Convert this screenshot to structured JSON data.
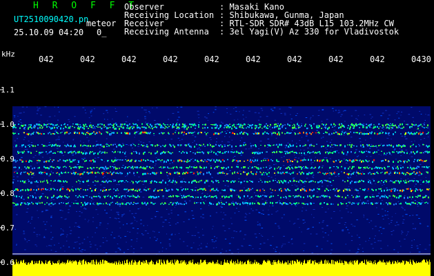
{
  "header": {
    "program": "H R O F F T",
    "filename": "UT2510090420.pn",
    "meteor_label": "meteor",
    "datetime": "25.10.09 04:20",
    "count": "0_"
  },
  "info": [
    {
      "label": "Observer",
      "value": ": Masaki Kano"
    },
    {
      "label": "Receiving Location",
      "value": ": Shibukawa, Gunma, Japan"
    },
    {
      "label": "Receiver",
      "value": ": RTL-SDR SDR# 43dB L15 103.2MHz CW"
    },
    {
      "label": "Receiving Antenna",
      "value": ": 3el Yagi(V) Az 330 for Vladivostok"
    }
  ],
  "axis": {
    "unit": "kHz",
    "y_ticks": [
      "1.1",
      "1.0",
      "0.9",
      "0.8",
      "0.7",
      "0.6"
    ],
    "x_ticks": [
      "042",
      "042",
      "042",
      "042",
      "042",
      "042",
      "042",
      "042",
      "042",
      "0430"
    ]
  },
  "colors": {
    "label_green": "#00ff00",
    "label_cyan": "#00ffff",
    "background_blue": "#000a6a",
    "signal_yellow": "#ffff00"
  }
}
